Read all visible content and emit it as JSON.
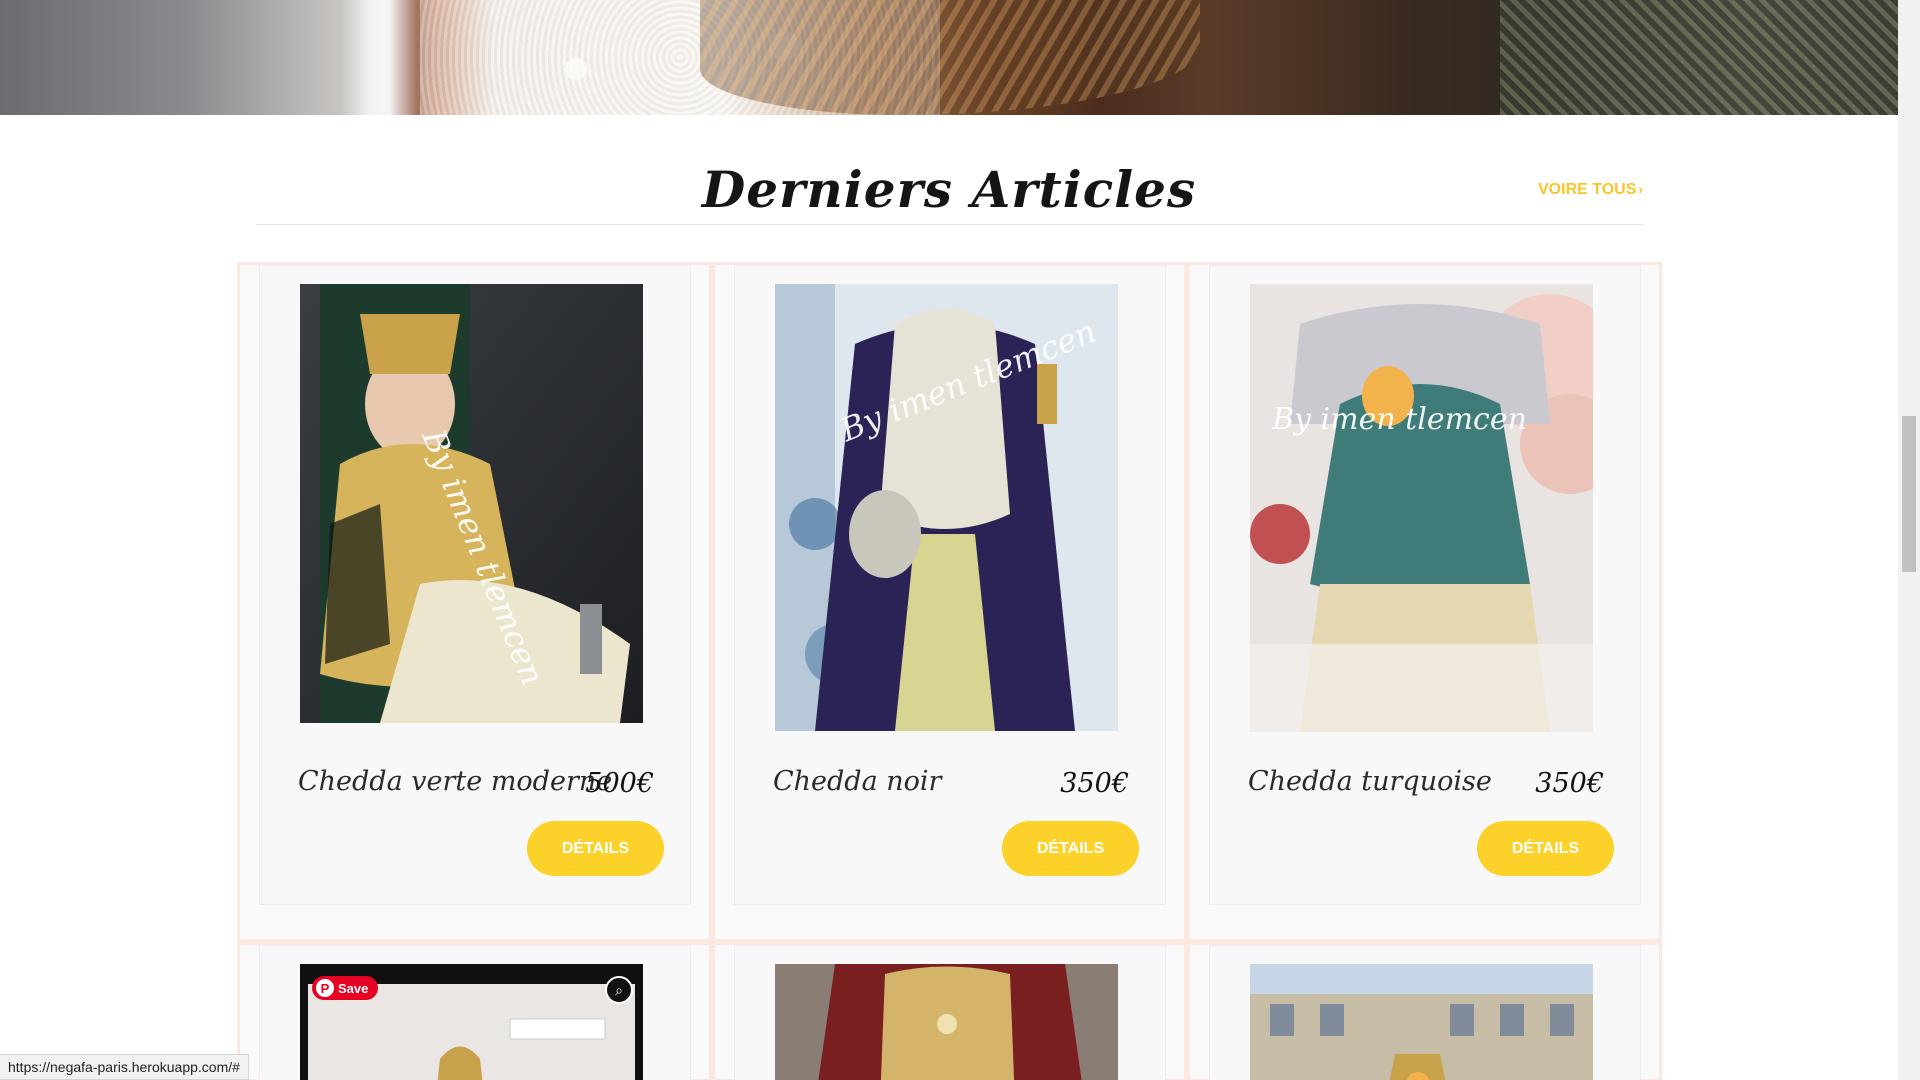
{
  "section": {
    "title": "Derniers Articles",
    "view_all_label": "VOIRE TOUS",
    "view_all_chevron": "›"
  },
  "products": [
    {
      "name": "Chedda verte moderne",
      "price": "500€",
      "details_label": "DÉTAILS",
      "watermark": "By imen tlemcen"
    },
    {
      "name": "Chedda noir",
      "price": "350€",
      "details_label": "DÉTAILS",
      "watermark": "By imen tlemcen"
    },
    {
      "name": "Chedda turquoise",
      "price": "350€",
      "details_label": "DÉTAILS",
      "watermark": "By imen tlemcen"
    }
  ],
  "pinterest": {
    "save_label": "Save",
    "p_glyph": "P"
  },
  "status_bar": {
    "url": "https://negafa-paris.herokuapp.com/#"
  },
  "colors": {
    "accent_yellow": "#fcd12a",
    "link_yellow": "#f7c62a",
    "column_border": "#fbe9e1"
  },
  "icons": {
    "chevron": "chevron-right-icon",
    "lens": "visual-search-icon"
  }
}
